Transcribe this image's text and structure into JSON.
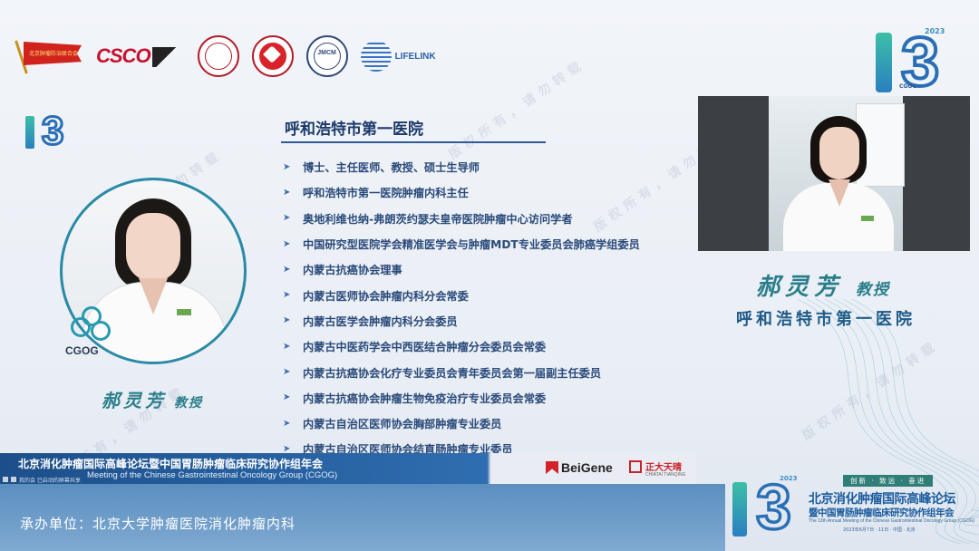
{
  "logos": {
    "flag_text": "北京肿瘤防治联合会",
    "csco": "CSCO",
    "jmcm": "JMCM",
    "lifelink": "LIFELINK"
  },
  "conference_logo": {
    "digit_one": "1",
    "digit_three": "3",
    "year": "2023",
    "abbr": "CGOG"
  },
  "speaker": {
    "name": "郝灵芳",
    "title": "教授",
    "hospital": "呼和浩特市第一医院",
    "org_logo": "CGOG"
  },
  "bio": {
    "heading": "呼和浩特市第一医院",
    "items": [
      "博士、主任医师、教授、硕士生导师",
      "呼和浩特市第一医院肿瘤内科主任",
      "奥地利维也纳-弗朗茨约瑟夫皇帝医院肿瘤中心访问学者",
      "中国研究型医院学会精准医学会与肿瘤MDT专业委员会肺癌学组委员",
      "内蒙古抗癌协会理事",
      "内蒙古医师协会肿瘤内科分会常委",
      "内蒙古医学会肿瘤内科分会委员",
      "内蒙古中医药学会中西医结合肿瘤分会委员会常委",
      "内蒙古抗癌协会化疗专业委员会青年委员会第一届副主任委员",
      "内蒙古抗癌协会肿瘤生物免疫治疗专业委员会常委",
      "内蒙古自治区医师协会胸部肿瘤专业委员",
      "内蒙古自治区医师协会结直肠肿瘤专业委员"
    ]
  },
  "banner": {
    "title_cn": "北京消化肿瘤国际高峰论坛暨中国胃肠肿瘤临床研究协作组年会",
    "title_en": "Meeting of the Chinese Gastrointestinal Oncology Group (CGOG)",
    "controls_text": "我的会 已启动的屏幕共享",
    "sponsor1": "BeiGene",
    "sponsor2": "正大天晴",
    "sponsor2_en": "CHIATAI TIANQING"
  },
  "organizer": {
    "text": "承办单位：北京大学肿瘤医院消化肿瘤内科"
  },
  "forum_logo": {
    "slogan": "创新 · 致远 · 奋进",
    "line1": "北京消化肿瘤国际高峰论坛",
    "line2": "暨中国胃肠肿瘤临床研究协作组年会",
    "line3": "The 13th Annual Meeting of the Chinese Gastrointestinal Oncology Group (CGOG)",
    "line4": "2023年6月7日 · 11日 · 中国 · 北京"
  },
  "watermark": "版权所有，请勿转载",
  "colors": {
    "accent": "#2a7e8a",
    "navy": "#1c3a6b",
    "banner": "#1c4f8a"
  }
}
